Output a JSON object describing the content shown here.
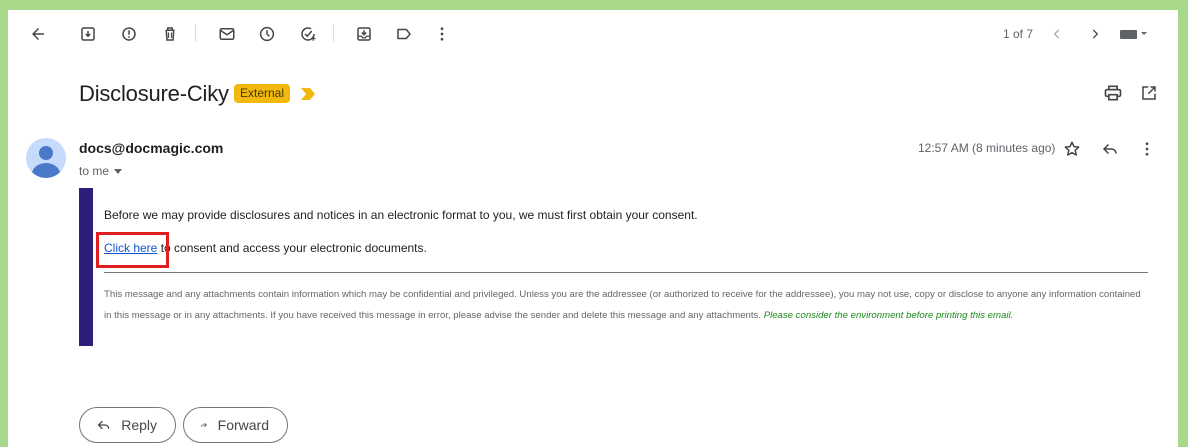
{
  "toolbar": {
    "counter": "1 of 7",
    "icons": [
      "back-arrow-icon",
      "archive-icon",
      "report-spam-icon",
      "delete-icon",
      "mark-unread-icon",
      "snooze-icon",
      "add-task-icon",
      "move-to-icon",
      "label-icon",
      "more-vert-icon",
      "newer-chevron-icon",
      "older-chevron-icon",
      "keyboard-input-icon"
    ]
  },
  "email": {
    "subject": "Disclosure-Ciky",
    "badge": "External",
    "sender": "docs@docmagic.com",
    "to": "to me",
    "time": "12:57 AM (8 minutes ago)",
    "body": {
      "line1": "Before we may provide disclosures and notices in an electronic format to you, we must first obtain your consent.",
      "link": "Click here",
      "line2_rest": " to consent and access your electronic documents.",
      "disclaimer": "This message and any attachments contain information which may be confidential and privileged. Unless you are the addressee (or authorized to receive for the addressee), you may not use, copy or disclose to anyone any information contained in this message or in any attachments. If you have received this message in error, please advise the sender and delete this message and any attachments.",
      "disclaimer_green": "Please consider the environment before printing this email."
    }
  },
  "actions": {
    "reply": "Reply",
    "forward": "Forward"
  },
  "colors": {
    "frame": "#a8d88a",
    "badge": "#f2b80e",
    "quote_bar": "#2f1d7a",
    "highlight": "#e02020",
    "link": "#1155cc"
  }
}
